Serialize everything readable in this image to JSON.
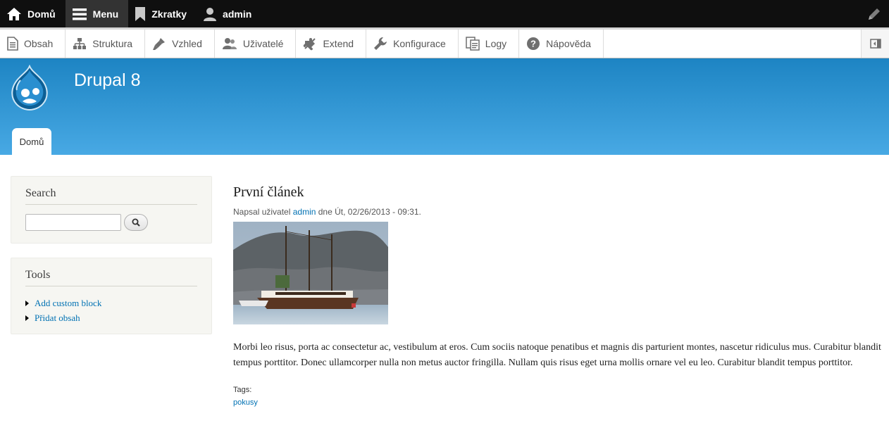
{
  "topbar": {
    "home_label": "Domů",
    "menu_label": "Menu",
    "shortcuts_label": "Zkratky",
    "user_label": "admin"
  },
  "tray": {
    "items": [
      {
        "label": "Obsah",
        "icon": "document-icon"
      },
      {
        "label": "Struktura",
        "icon": "sitemap-icon"
      },
      {
        "label": "Vzhled",
        "icon": "paintbrush-icon"
      },
      {
        "label": "Uživatelé",
        "icon": "people-icon"
      },
      {
        "label": "Extend",
        "icon": "puzzle-icon"
      },
      {
        "label": "Konfigurace",
        "icon": "wrench-icon"
      },
      {
        "label": "Logy",
        "icon": "report-icon"
      },
      {
        "label": "Nápověda",
        "icon": "help-icon"
      }
    ]
  },
  "header": {
    "site_name": "Drupal 8",
    "tab_home": "Domů"
  },
  "sidebar": {
    "search_title": "Search",
    "tools_title": "Tools",
    "tools_links": [
      "Add custom block",
      "Přidat obsah"
    ]
  },
  "article": {
    "title": "První článek",
    "meta_prefix": "Napsal uživatel ",
    "author": "admin",
    "meta_suffix": " dne Út, 02/26/2013 - 09:31.",
    "body": "Morbi leo risus, porta ac consectetur ac, vestibulum at eros. Cum sociis natoque penatibus et magnis dis parturient montes, nascetur ridiculus mus. Curabitur blandit tempus porttitor. Donec ullamcorper nulla non metus auctor fringilla. Nullam quis risus eget urna mollis ornare vel eu leo. Curabitur blandit tempus porttitor.",
    "tags_label": "Tags:",
    "tag": "pokusy"
  },
  "colors": {
    "header_top": "#1d84c3",
    "header_bottom": "#48a9e4",
    "link": "#0071b3",
    "toolbar": "#0f0f0f"
  }
}
